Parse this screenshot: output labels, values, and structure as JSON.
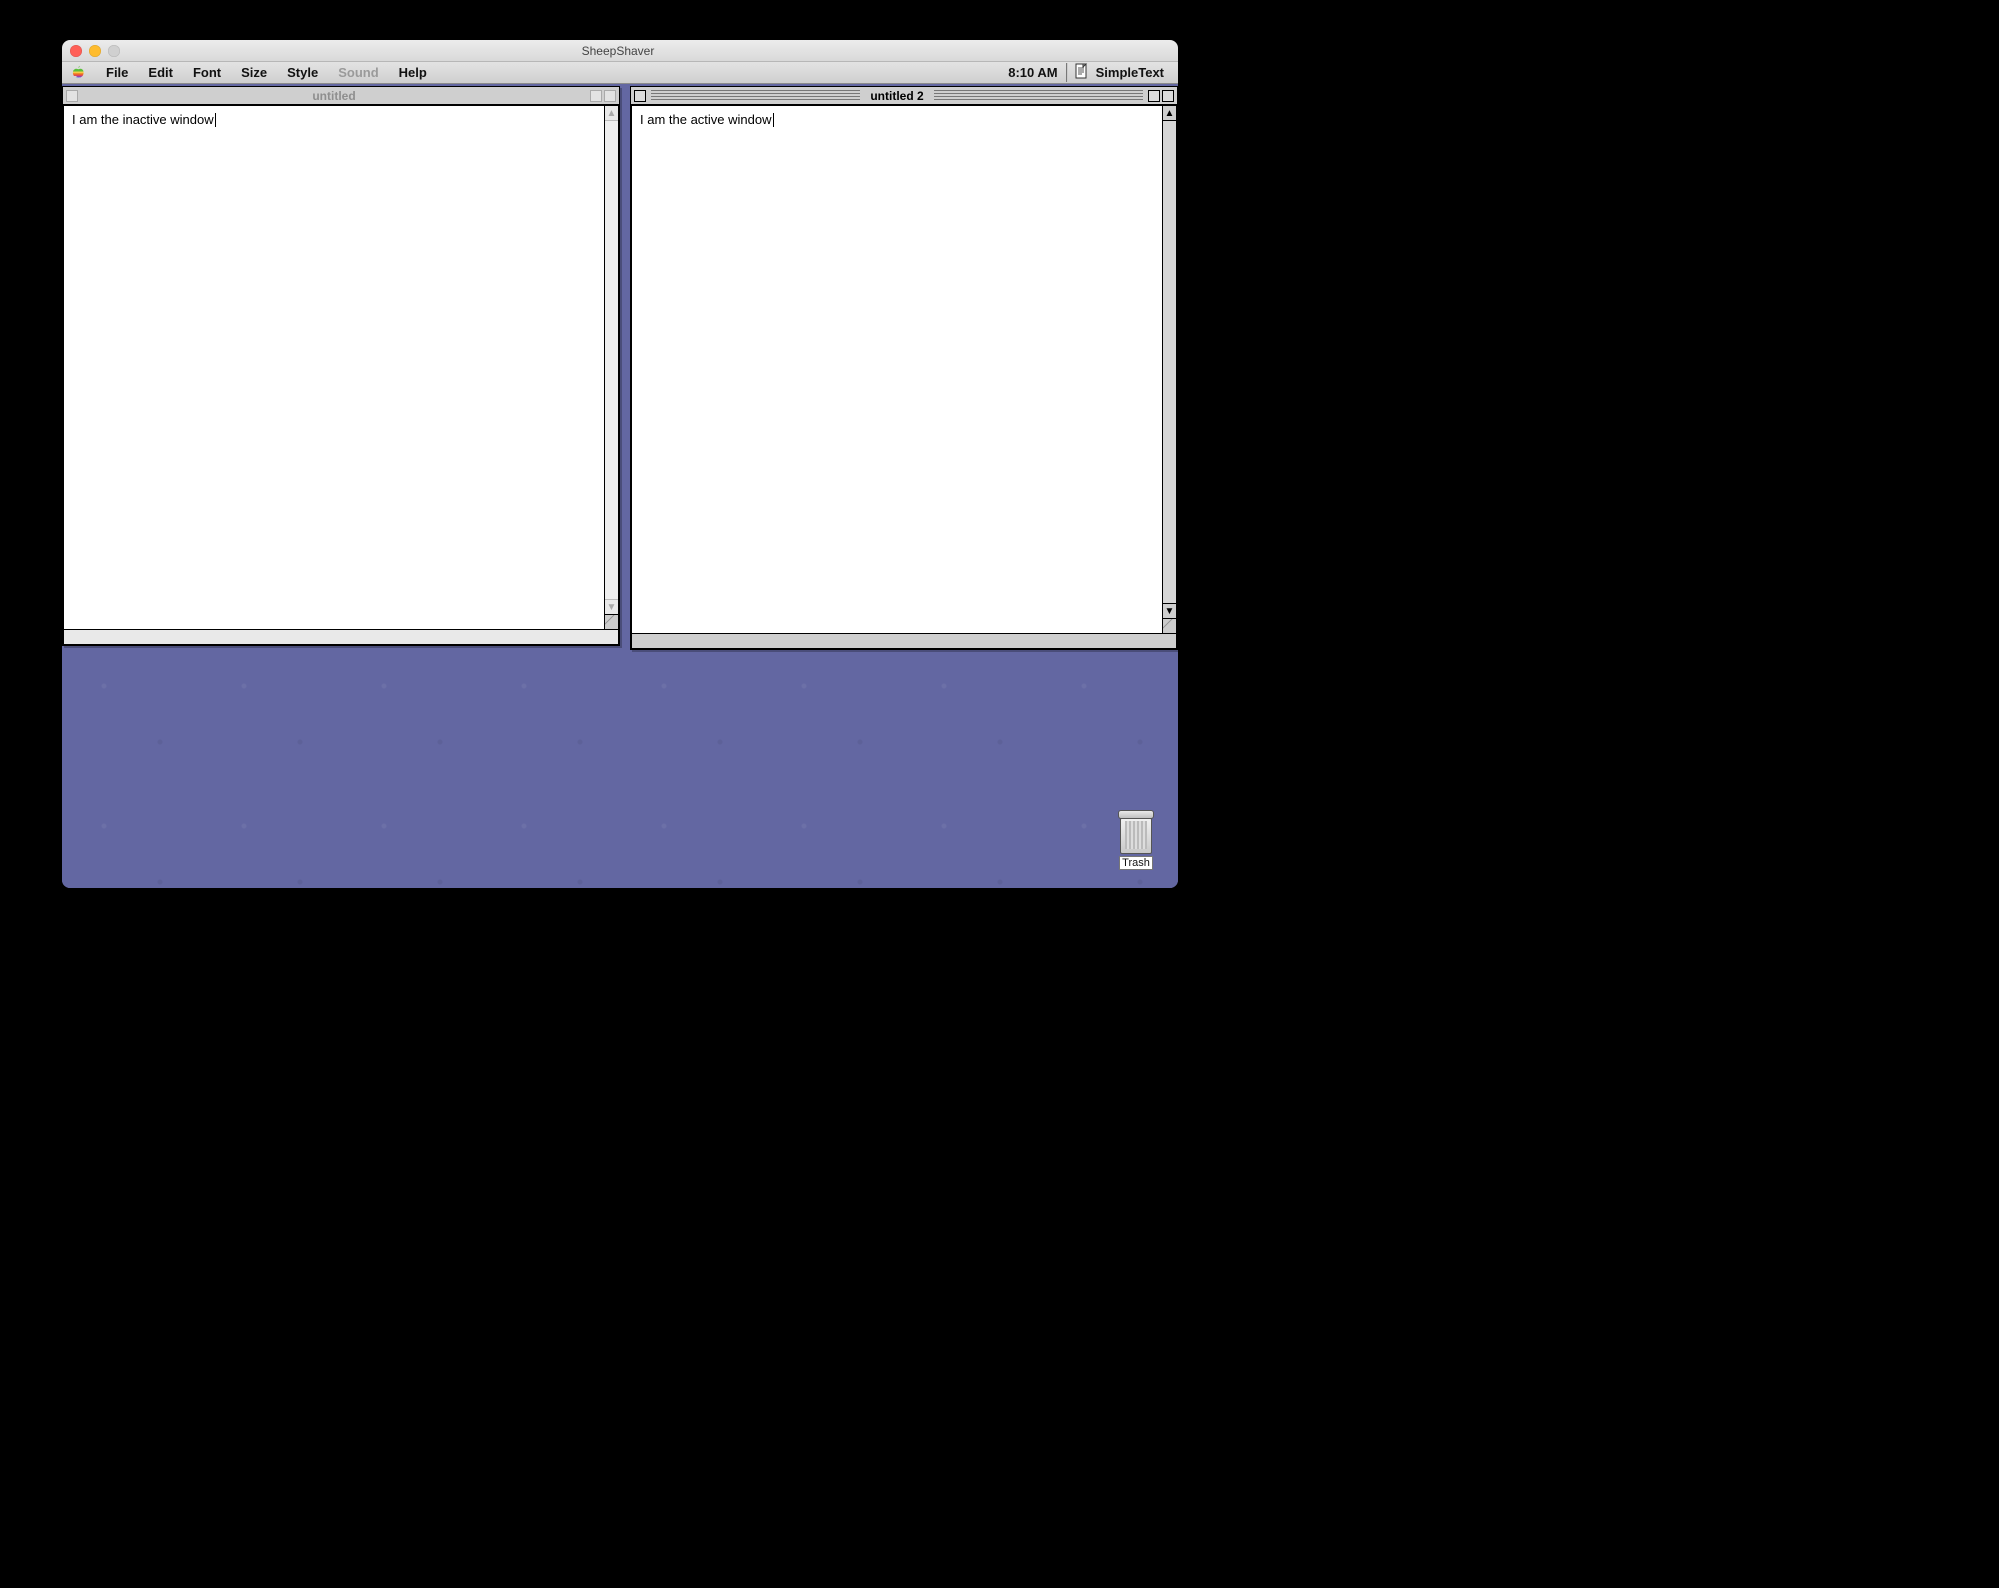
{
  "host": {
    "title": "SheepShaver"
  },
  "menubar": {
    "items": [
      "File",
      "Edit",
      "Font",
      "Size",
      "Style",
      "Sound",
      "Help"
    ],
    "disabled_index": 5,
    "clock": "8:10 AM",
    "app_name": "SimpleText"
  },
  "windows": {
    "inactive": {
      "title": "untitled",
      "text": "I am the inactive window"
    },
    "active": {
      "title": "untitled 2",
      "text": "I am the active window"
    }
  },
  "desktop": {
    "trash_label": "Trash"
  }
}
